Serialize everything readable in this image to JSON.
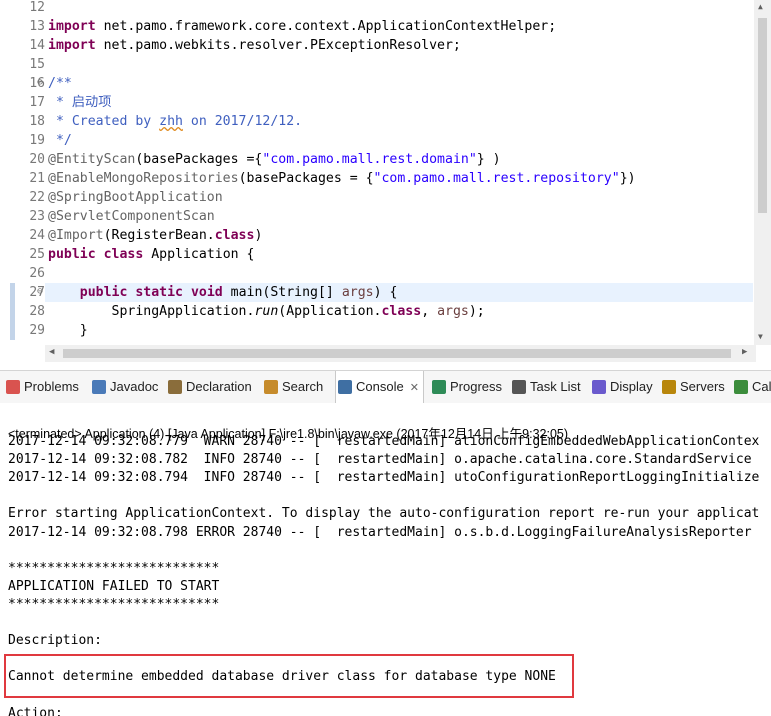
{
  "editor": {
    "lines": [
      {
        "n": "12",
        "parts": []
      },
      {
        "n": "13",
        "parts": [
          {
            "t": "import",
            "c": "kw"
          },
          {
            "t": " net.pamo.framework.core.context.ApplicationContextHelper;",
            "c": ""
          }
        ]
      },
      {
        "n": "14",
        "parts": [
          {
            "t": "import",
            "c": "kw"
          },
          {
            "t": " net.pamo.webkits.resolver.PExceptionResolver;",
            "c": ""
          }
        ]
      },
      {
        "n": "15",
        "parts": []
      },
      {
        "n": "16",
        "parts": [
          {
            "t": "/**",
            "c": "doc"
          }
        ]
      },
      {
        "n": "17",
        "parts": [
          {
            "t": " * 启动项",
            "c": "doc"
          }
        ]
      },
      {
        "n": "18",
        "parts": [
          {
            "t": " * Created by ",
            "c": "doc"
          },
          {
            "t": "zhh",
            "c": "doc"
          },
          {
            "t": " on 2017/12/12.",
            "c": "doc"
          }
        ]
      },
      {
        "n": "19",
        "parts": [
          {
            "t": " */",
            "c": "doc"
          }
        ]
      },
      {
        "n": "20",
        "parts": [
          {
            "t": "@EntityScan",
            "c": "ann"
          },
          {
            "t": "(basePackages ={",
            "c": ""
          },
          {
            "t": "\"com.pamo.mall.rest.domain\"",
            "c": "str"
          },
          {
            "t": "} )",
            "c": ""
          }
        ]
      },
      {
        "n": "21",
        "parts": [
          {
            "t": "@EnableMongoRepositories",
            "c": "ann"
          },
          {
            "t": "(basePackages = {",
            "c": ""
          },
          {
            "t": "\"com.pamo.mall.rest.repository\"",
            "c": "str"
          },
          {
            "t": "})",
            "c": ""
          }
        ]
      },
      {
        "n": "22",
        "parts": [
          {
            "t": "@SpringBootApplication",
            "c": "ann"
          }
        ]
      },
      {
        "n": "23",
        "parts": [
          {
            "t": "@ServletComponentScan",
            "c": "ann"
          }
        ]
      },
      {
        "n": "24",
        "parts": [
          {
            "t": "@Import",
            "c": "ann"
          },
          {
            "t": "(RegisterBean.",
            "c": ""
          },
          {
            "t": "class",
            "c": "kw"
          },
          {
            "t": ")",
            "c": ""
          }
        ]
      },
      {
        "n": "25",
        "parts": [
          {
            "t": "public",
            "c": "kw"
          },
          {
            "t": " ",
            "c": ""
          },
          {
            "t": "class",
            "c": "kw"
          },
          {
            "t": " Application {",
            "c": ""
          }
        ]
      },
      {
        "n": "26",
        "parts": []
      },
      {
        "n": "27",
        "parts": [
          {
            "t": "    ",
            "c": ""
          },
          {
            "t": "public",
            "c": "kw"
          },
          {
            "t": " ",
            "c": ""
          },
          {
            "t": "static",
            "c": "kw"
          },
          {
            "t": " ",
            "c": ""
          },
          {
            "t": "void",
            "c": "kw"
          },
          {
            "t": " main(String[] ",
            "c": ""
          },
          {
            "t": "args",
            "c": "param"
          },
          {
            "t": ") {",
            "c": ""
          }
        ]
      },
      {
        "n": "28",
        "parts": [
          {
            "t": "        SpringApplication.",
            "c": ""
          },
          {
            "t": "run",
            "c": "ital"
          },
          {
            "t": "(Application.",
            "c": ""
          },
          {
            "t": "class",
            "c": "kw"
          },
          {
            "t": ", ",
            "c": ""
          },
          {
            "t": "args",
            "c": "param"
          },
          {
            "t": ");",
            "c": ""
          }
        ]
      },
      {
        "n": "29",
        "parts": [
          {
            "t": "    }",
            "c": ""
          }
        ]
      }
    ]
  },
  "tabs": [
    {
      "label": "Problems",
      "icon": "problems-icon",
      "color": "#d9534f"
    },
    {
      "label": "Javadoc",
      "icon": "javadoc-icon",
      "color": "#4a7ab8"
    },
    {
      "label": "Declaration",
      "icon": "declaration-icon",
      "color": "#8a6d3b"
    },
    {
      "label": "Search",
      "icon": "search-icon",
      "color": "#c68b2b"
    },
    {
      "label": "Console",
      "icon": "console-icon",
      "color": "#3f6fa3"
    },
    {
      "label": "Progress",
      "icon": "progress-icon",
      "color": "#2e8b57"
    },
    {
      "label": "Task List",
      "icon": "task-list-icon",
      "color": "#555555"
    },
    {
      "label": "Display",
      "icon": "display-icon",
      "color": "#6a5acd"
    },
    {
      "label": "Servers",
      "icon": "servers-icon",
      "color": "#b8860b"
    },
    {
      "label": "Cal",
      "icon": "call-hierarchy-icon",
      "color": "#3c8d3c"
    }
  ],
  "console": {
    "header": "<terminated> Application (4) [Java Application] F:\\jre1.8\\bin\\javaw.exe (2017年12月14日 上午9:32:05)",
    "lines": [
      "2017-12-14 09:32:08.779  WARN 28740 -- [  restartedMain] ationConfigEmbeddedWebApplicationContex",
      "2017-12-14 09:32:08.782  INFO 28740 -- [  restartedMain] o.apache.catalina.core.StandardService",
      "2017-12-14 09:32:08.794  INFO 28740 -- [  restartedMain] utoConfigurationReportLoggingInitialize",
      "",
      "Error starting ApplicationContext. To display the auto-configuration report re-run your applicat",
      "2017-12-14 09:32:08.798 ERROR 28740 -- [  restartedMain] o.s.b.d.LoggingFailureAnalysisReporter",
      "",
      "***************************",
      "APPLICATION FAILED TO START",
      "***************************",
      "",
      "Description:",
      "",
      "Cannot determine embedded database driver class for database type NONE",
      "",
      "Action:"
    ]
  }
}
